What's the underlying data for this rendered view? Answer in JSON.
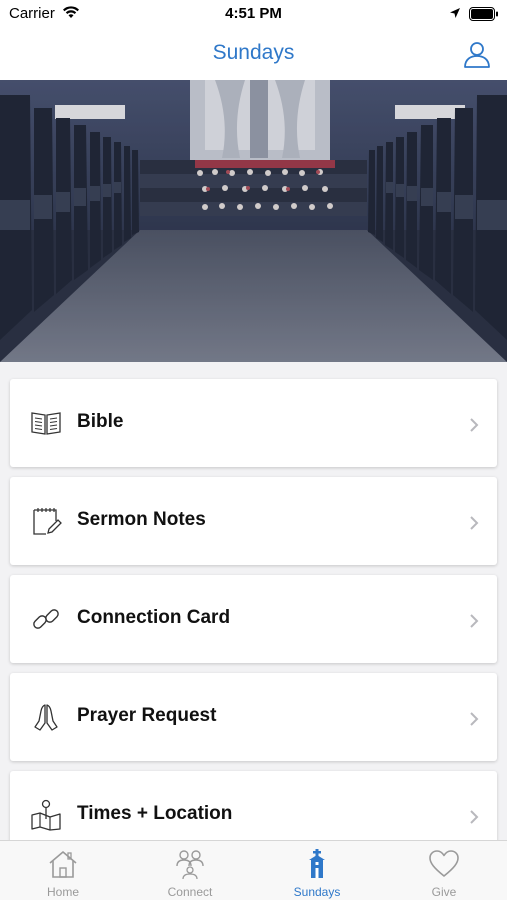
{
  "status_bar": {
    "carrier": "Carrier",
    "time": "4:51 PM"
  },
  "nav": {
    "title": "Sundays",
    "profile_icon": "person-icon"
  },
  "menu": {
    "items": [
      {
        "label": "Bible",
        "icon": "book-icon"
      },
      {
        "label": "Sermon Notes",
        "icon": "notepad-icon"
      },
      {
        "label": "Connection Card",
        "icon": "link-icon"
      },
      {
        "label": "Prayer Request",
        "icon": "praying-hands-icon"
      },
      {
        "label": "Times + Location",
        "icon": "map-pin-icon"
      }
    ]
  },
  "tabs": [
    {
      "label": "Home",
      "icon": "house-icon",
      "active": false
    },
    {
      "label": "Connect",
      "icon": "people-icon",
      "active": false
    },
    {
      "label": "Sundays",
      "icon": "church-icon",
      "active": true
    },
    {
      "label": "Give",
      "icon": "heart-icon",
      "active": false
    }
  ],
  "colors": {
    "accent": "#2f78c9",
    "inactive": "#9a9a9a"
  }
}
